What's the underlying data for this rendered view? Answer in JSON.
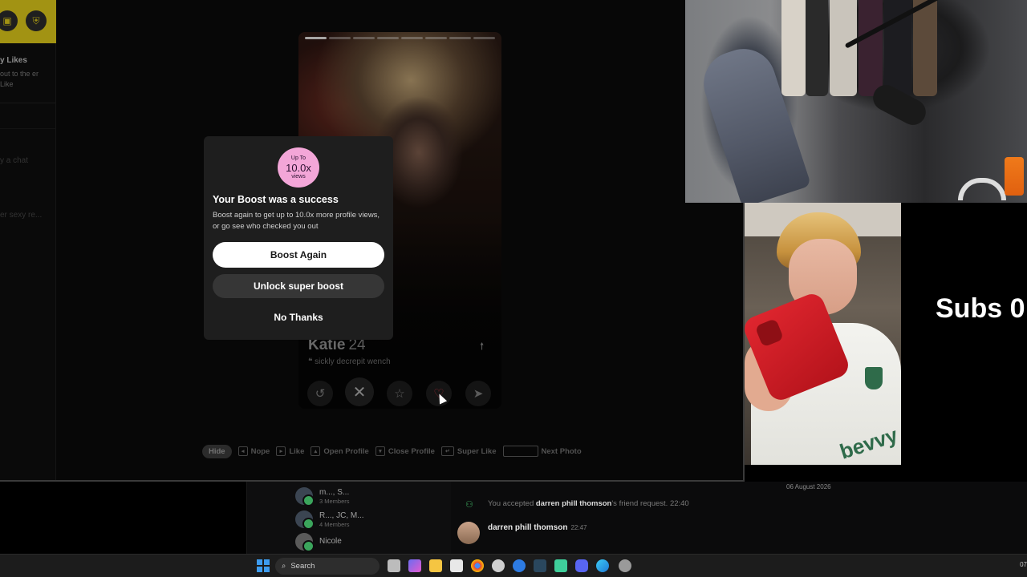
{
  "sidebar": {
    "heading": "y Likes",
    "subtext": "out to the er Like",
    "snippet1": "y a chat",
    "snippet2": "er sexy re...",
    "icon_left": "briefcase-icon",
    "icon_right": "shield-icon"
  },
  "card": {
    "name": "Katie",
    "age": "24",
    "bio": "sickly decrepit wench",
    "bio_icon": "quote-icon",
    "expand_icon": "arrow-up-icon"
  },
  "actions": [
    {
      "name": "rewind-button",
      "icon": "↺"
    },
    {
      "name": "nope-button",
      "icon": "✕"
    },
    {
      "name": "super-like-button",
      "icon": "☆"
    },
    {
      "name": "like-button",
      "icon": "♡"
    },
    {
      "name": "boost-button",
      "icon": "➤"
    }
  ],
  "hints": {
    "hide": "Hide",
    "nope": "Nope",
    "like": "Like",
    "open_profile": "Open Profile",
    "close_profile": "Close Profile",
    "super_like": "Super Like",
    "next_photo": "Next Photo"
  },
  "modal": {
    "badge_top": "Up To",
    "badge_main": "10.0x",
    "badge_bottom": "views",
    "title": "Your Boost was a success",
    "description": "Boost again to get up to 10.0x more profile views, or go see who checked you out",
    "boost_again": "Boost Again",
    "unlock": "Unlock super boost",
    "no_thanks": "No Thanks"
  },
  "overlay": {
    "subs_text": "Subs 0"
  },
  "discord": {
    "dms": [
      {
        "name": "m..., S...",
        "sub": "3 Members"
      },
      {
        "name": "R..., JC, M...",
        "sub": "4 Members"
      },
      {
        "name": "Nicole",
        "sub": ""
      }
    ],
    "date": "06 August 2026",
    "system_prefix": "You accepted ",
    "system_user": "darren phill thomson",
    "system_suffix": "'s friend request.",
    "system_time": "22:40",
    "message_author": "darren phill thomson",
    "message_time": "22:47"
  },
  "taskbar": {
    "search_placeholder": "Search",
    "clock": "07"
  },
  "colors": {
    "tinder_yellow": "#d8c41a",
    "boost_badge": "#f3a6d8",
    "discord_green": "#3ba55c"
  }
}
